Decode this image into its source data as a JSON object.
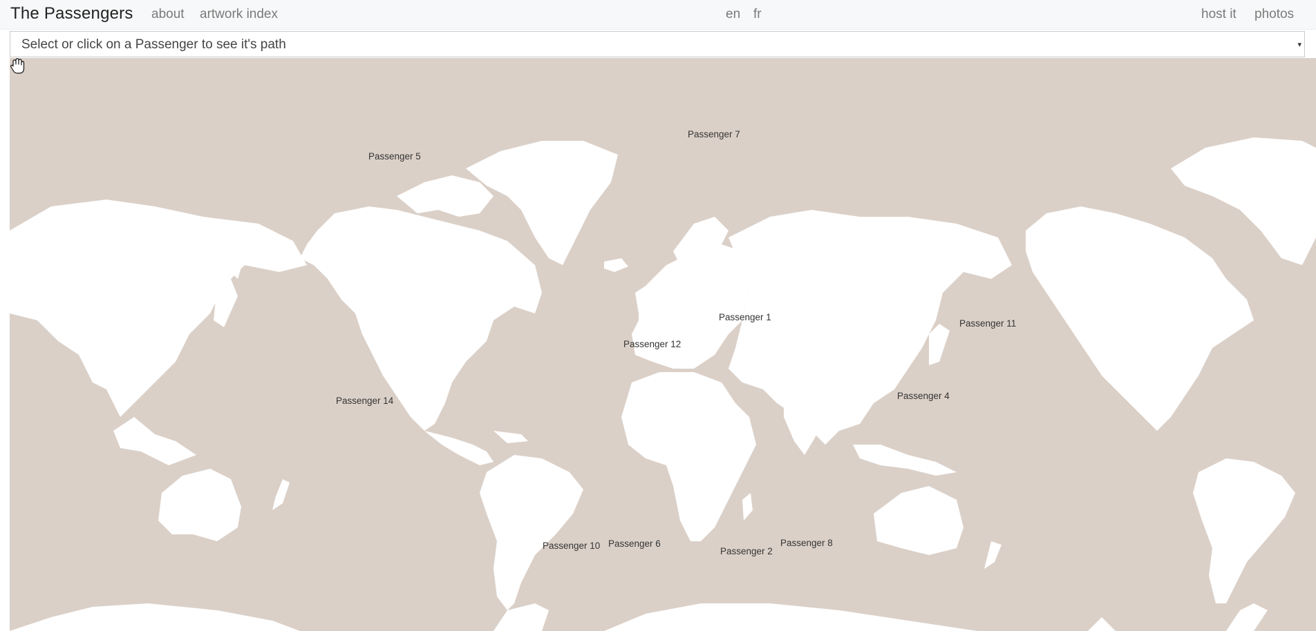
{
  "app": {
    "brand": "The Passengers"
  },
  "nav": {
    "about": "about",
    "artwork_index": "artwork index",
    "lang_en": "en",
    "lang_fr": "fr",
    "host_it": "host it",
    "photos": "photos"
  },
  "selector": {
    "placeholder": "Select or click on a Passenger to see it's path",
    "caret": "▾"
  },
  "map": {
    "land_color": "#ffffff",
    "ocean_color": "#dbd0c8",
    "projection": "mercator",
    "cursor_icon": "hand-grab-icon",
    "markers": [
      {
        "name": "Passenger 1"
      },
      {
        "name": "Passenger 2"
      },
      {
        "name": "Passenger 4"
      },
      {
        "name": "Passenger 5"
      },
      {
        "name": "Passenger 6"
      },
      {
        "name": "Passenger 7"
      },
      {
        "name": "Passenger 8"
      },
      {
        "name": "Passenger 10"
      },
      {
        "name": "Passenger 11"
      },
      {
        "name": "Passenger 12"
      },
      {
        "name": "Passenger 14"
      }
    ]
  }
}
